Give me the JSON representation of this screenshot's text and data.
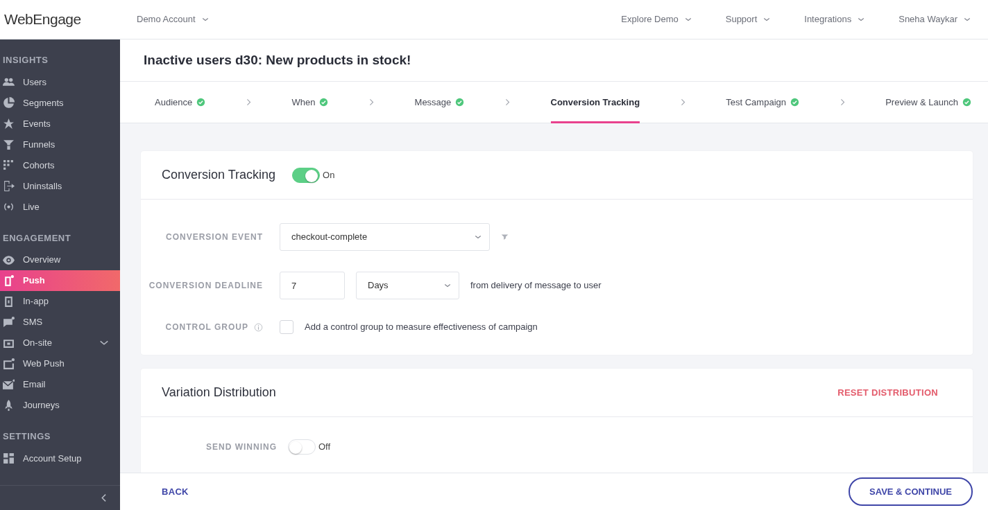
{
  "topbar": {
    "logo": "WebEngage",
    "account": "Demo Account",
    "menus": [
      "Explore Demo",
      "Support",
      "Integrations",
      "Sneha Waykar"
    ]
  },
  "sidebar": {
    "sections": [
      {
        "title": "INSIGHTS",
        "items": [
          {
            "label": "Users",
            "selected": false
          },
          {
            "label": "Segments",
            "selected": false
          },
          {
            "label": "Events",
            "selected": false
          },
          {
            "label": "Funnels",
            "selected": false
          },
          {
            "label": "Cohorts",
            "selected": false
          },
          {
            "label": "Uninstalls",
            "selected": false
          },
          {
            "label": "Live",
            "selected": false
          }
        ]
      },
      {
        "title": "ENGAGEMENT",
        "items": [
          {
            "label": "Overview",
            "selected": false
          },
          {
            "label": "Push",
            "selected": true
          },
          {
            "label": "In-app",
            "selected": false
          },
          {
            "label": "SMS",
            "selected": false
          },
          {
            "label": "On-site",
            "selected": false,
            "expandable": true
          },
          {
            "label": "Web Push",
            "selected": false
          },
          {
            "label": "Email",
            "selected": false
          },
          {
            "label": "Journeys",
            "selected": false
          }
        ]
      },
      {
        "title": "SETTINGS",
        "items": [
          {
            "label": "Account Setup",
            "selected": false
          }
        ]
      }
    ]
  },
  "page_title": "Inactive users d30: New products in stock!",
  "steps": [
    {
      "label": "Audience",
      "completed": true,
      "selected": false
    },
    {
      "label": "When",
      "completed": true,
      "selected": false
    },
    {
      "label": "Message",
      "completed": true,
      "selected": false
    },
    {
      "label": "Conversion Tracking",
      "completed": false,
      "selected": true
    },
    {
      "label": "Test Campaign",
      "completed": true,
      "selected": false
    },
    {
      "label": "Preview & Launch",
      "completed": true,
      "selected": false
    }
  ],
  "conversion_card": {
    "title": "Conversion Tracking",
    "toggle": {
      "on": true,
      "label": "On"
    },
    "event": {
      "label": "CONVERSION EVENT",
      "value": "checkout-complete"
    },
    "deadline": {
      "label": "CONVERSION DEADLINE",
      "value": "7",
      "unit": "Days",
      "note": "from delivery of message to user"
    },
    "control_group": {
      "label": "CONTROL GROUP",
      "checked": false,
      "text": "Add a control group to measure effectiveness of campaign"
    }
  },
  "variation_card": {
    "title": "Variation Distribution",
    "action": "RESET DISTRIBUTION",
    "send_winning": {
      "label": "SEND WINNING",
      "toggle": {
        "on": false,
        "label": "Off"
      }
    }
  },
  "footer": {
    "back": "BACK",
    "save": "SAVE & CONTINUE"
  }
}
